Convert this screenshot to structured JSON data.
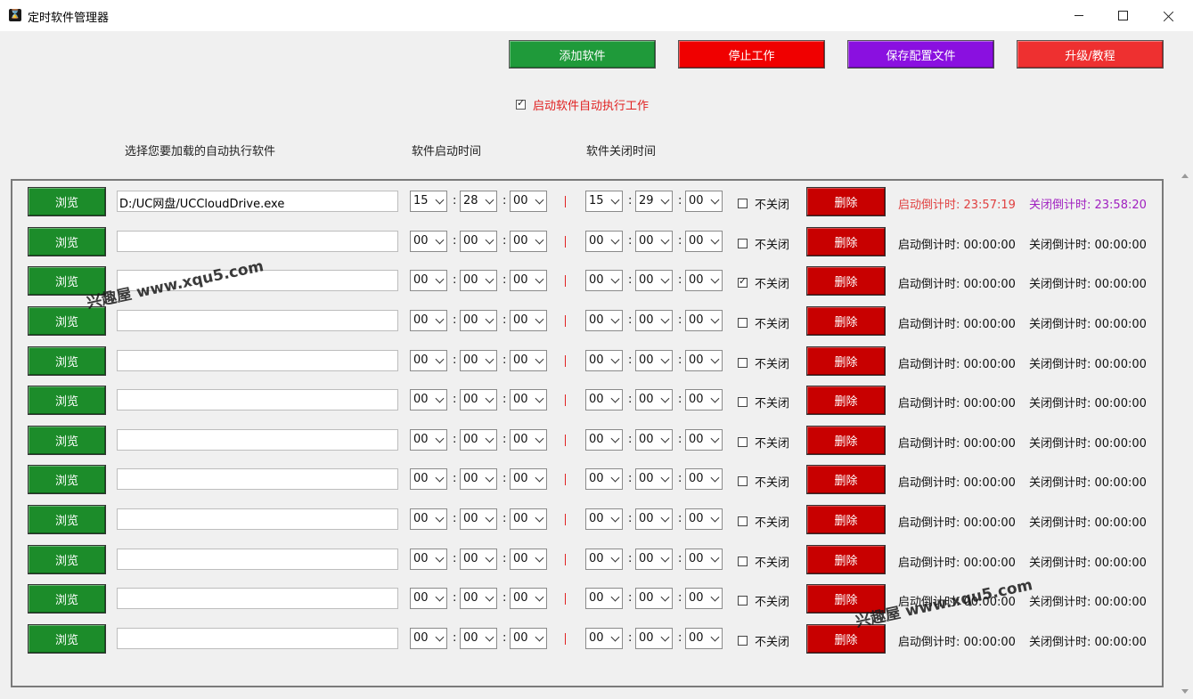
{
  "window": {
    "title": "定时软件管理器",
    "icon": "hourglass-icon"
  },
  "toolbar": [
    {
      "label": "添加软件",
      "color": "#1f9a3a"
    },
    {
      "label": "停止工作",
      "color": "#f00000"
    },
    {
      "label": "保存配置文件",
      "color": "#8a10e0"
    },
    {
      "label": "升级/教程",
      "color": "#ee3030"
    }
  ],
  "autostart": {
    "label": "启动软件自动执行工作",
    "checked": true
  },
  "headers": {
    "software": "选择您要加载的自动执行软件",
    "start_time": "软件启动时间",
    "close_time": "软件关闭时间"
  },
  "labels": {
    "browse": "浏览",
    "no_close": "不关闭",
    "delete": "删除",
    "colon": ":"
  },
  "rows": [
    {
      "path": "D:/UC网盘/UCCloudDrive.exe",
      "start": [
        "15",
        "28",
        "00"
      ],
      "close": [
        "15",
        "29",
        "00"
      ],
      "no_close": false,
      "start_cd": "启动倒计时: 23:57:19",
      "close_cd": "关闭倒计时: 23:58:20",
      "active": true
    },
    {
      "path": "",
      "start": [
        "00",
        "00",
        "00"
      ],
      "close": [
        "00",
        "00",
        "00"
      ],
      "no_close": false,
      "start_cd": "启动倒计时: 00:00:00",
      "close_cd": "关闭倒计时: 00:00:00",
      "active": false
    },
    {
      "path": "",
      "start": [
        "00",
        "00",
        "00"
      ],
      "close": [
        "00",
        "00",
        "00"
      ],
      "no_close": true,
      "start_cd": "启动倒计时: 00:00:00",
      "close_cd": "关闭倒计时: 00:00:00",
      "active": false
    },
    {
      "path": "",
      "start": [
        "00",
        "00",
        "00"
      ],
      "close": [
        "00",
        "00",
        "00"
      ],
      "no_close": false,
      "start_cd": "启动倒计时: 00:00:00",
      "close_cd": "关闭倒计时: 00:00:00",
      "active": false
    },
    {
      "path": "",
      "start": [
        "00",
        "00",
        "00"
      ],
      "close": [
        "00",
        "00",
        "00"
      ],
      "no_close": false,
      "start_cd": "启动倒计时: 00:00:00",
      "close_cd": "关闭倒计时: 00:00:00",
      "active": false
    },
    {
      "path": "",
      "start": [
        "00",
        "00",
        "00"
      ],
      "close": [
        "00",
        "00",
        "00"
      ],
      "no_close": false,
      "start_cd": "启动倒计时: 00:00:00",
      "close_cd": "关闭倒计时: 00:00:00",
      "active": false
    },
    {
      "path": "",
      "start": [
        "00",
        "00",
        "00"
      ],
      "close": [
        "00",
        "00",
        "00"
      ],
      "no_close": false,
      "start_cd": "启动倒计时: 00:00:00",
      "close_cd": "关闭倒计时: 00:00:00",
      "active": false
    },
    {
      "path": "",
      "start": [
        "00",
        "00",
        "00"
      ],
      "close": [
        "00",
        "00",
        "00"
      ],
      "no_close": false,
      "start_cd": "启动倒计时: 00:00:00",
      "close_cd": "关闭倒计时: 00:00:00",
      "active": false
    },
    {
      "path": "",
      "start": [
        "00",
        "00",
        "00"
      ],
      "close": [
        "00",
        "00",
        "00"
      ],
      "no_close": false,
      "start_cd": "启动倒计时: 00:00:00",
      "close_cd": "关闭倒计时: 00:00:00",
      "active": false
    },
    {
      "path": "",
      "start": [
        "00",
        "00",
        "00"
      ],
      "close": [
        "00",
        "00",
        "00"
      ],
      "no_close": false,
      "start_cd": "启动倒计时: 00:00:00",
      "close_cd": "关闭倒计时: 00:00:00",
      "active": false
    },
    {
      "path": "",
      "start": [
        "00",
        "00",
        "00"
      ],
      "close": [
        "00",
        "00",
        "00"
      ],
      "no_close": false,
      "start_cd": "启动倒计时: 00:00:00",
      "close_cd": "关闭倒计时: 00:00:00",
      "active": false
    },
    {
      "path": "",
      "start": [
        "00",
        "00",
        "00"
      ],
      "close": [
        "00",
        "00",
        "00"
      ],
      "no_close": false,
      "start_cd": "启动倒计时: 00:00:00",
      "close_cd": "关闭倒计时: 00:00:00",
      "active": false
    }
  ],
  "colors": {
    "active_start_cd": "#e04040",
    "active_close_cd": "#a020c0",
    "idle_cd": "#111111"
  },
  "watermarks": [
    "兴趣屋 www.xqu5.com",
    "兴趣屋 www.xqu5.com"
  ]
}
